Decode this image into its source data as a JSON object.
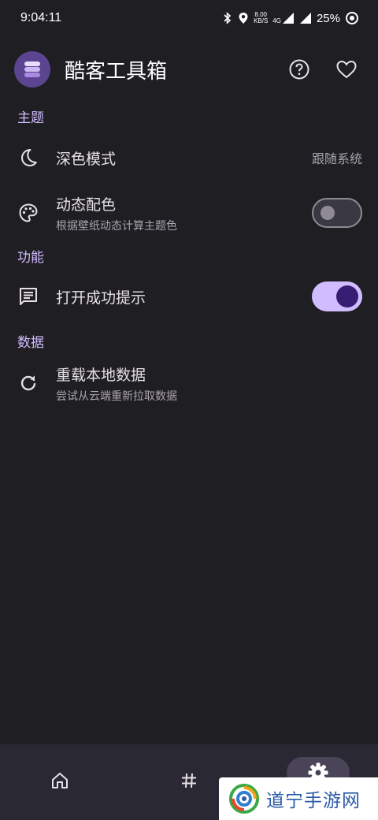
{
  "status_bar": {
    "time": "9:04:11",
    "net_speed_value": "8.00",
    "net_speed_unit": "KB/S",
    "network_type": "4G",
    "battery": "25%"
  },
  "app_bar": {
    "title": "酷客工具箱",
    "logo_icon": "stack-layers-icon",
    "actions": [
      "help-icon",
      "heart-icon"
    ]
  },
  "sections": {
    "theme": {
      "header": "主题",
      "dark_mode": {
        "title": "深色模式",
        "value": "跟随系统",
        "icon": "moon-icon"
      },
      "dynamic_color": {
        "title": "动态配色",
        "subtitle": "根据壁纸动态计算主题色",
        "icon": "palette-icon",
        "enabled": false
      }
    },
    "features": {
      "header": "功能",
      "open_success_hint": {
        "title": "打开成功提示",
        "icon": "message-list-icon",
        "enabled": true
      }
    },
    "data": {
      "header": "数据",
      "reload_local_data": {
        "title": "重载本地数据",
        "subtitle": "尝试从云端重新拉取数据",
        "icon": "refresh-icon"
      }
    }
  },
  "bottom_nav": {
    "items": [
      {
        "icon": "home-icon",
        "selected": false
      },
      {
        "icon": "hashtag-icon",
        "selected": false
      },
      {
        "icon": "gear-icon",
        "selected": true
      }
    ]
  },
  "watermark": {
    "text": "道宁手游网"
  },
  "colors": {
    "background": "#1f1e22",
    "accent": "#d0bcff",
    "switch_knob_on": "#381e72",
    "nav_background": "#2a2833"
  }
}
